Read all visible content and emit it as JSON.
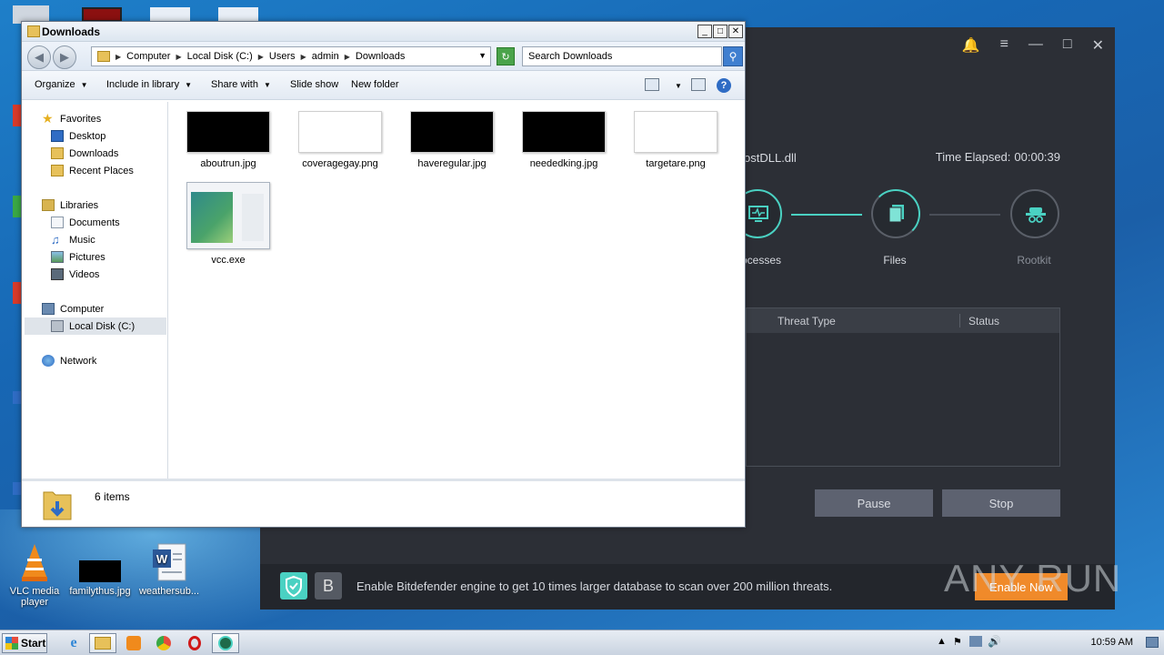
{
  "desktop": {
    "icons": [
      {
        "label": "VLC media player"
      },
      {
        "label": "familythus.jpg"
      },
      {
        "label": "weathersub..."
      }
    ]
  },
  "av_app": {
    "current_file": "ostDLL.dll",
    "elapsed_label": "Time Elapsed:",
    "elapsed_value": "00:00:39",
    "steps": [
      {
        "label": "ocesses",
        "icon": "monitor-icon"
      },
      {
        "label": "Files",
        "icon": "files-icon"
      },
      {
        "label": "Rootkit",
        "icon": "spy-icon"
      }
    ],
    "table_headers": [
      "Threat Type",
      "Status"
    ],
    "pause_label": "Pause",
    "stop_label": "Stop",
    "banner_letter": "B",
    "banner_message": "Enable Bitdefender engine to get 10 times larger database to scan over 200 million threats.",
    "enable_label": "Enable Now",
    "accent": "#4ad1c2"
  },
  "watermark": "ANY RUN",
  "explorer": {
    "title": "Downloads",
    "breadcrumb": [
      "Computer",
      "Local Disk (C:)",
      "Users",
      "admin",
      "Downloads"
    ],
    "search_placeholder": "Search Downloads",
    "toolbar": {
      "organize": "Organize",
      "include_in_library": "Include in library",
      "share_with": "Share with",
      "slide_show": "Slide show",
      "new_folder": "New folder"
    },
    "nav": {
      "favorites": "Favorites",
      "desktop": "Desktop",
      "downloads": "Downloads",
      "recent_places": "Recent Places",
      "libraries": "Libraries",
      "documents": "Documents",
      "music": "Music",
      "pictures": "Pictures",
      "videos": "Videos",
      "computer": "Computer",
      "local_disk": "Local Disk (C:)",
      "network": "Network"
    },
    "files": [
      {
        "name": "aboutrun.jpg"
      },
      {
        "name": "coveragegay.png"
      },
      {
        "name": "haveregular.jpg"
      },
      {
        "name": "neededking.jpg"
      },
      {
        "name": "targetare.png"
      },
      {
        "name": "vcc.exe"
      }
    ],
    "status_count": "6 items"
  },
  "taskbar": {
    "start_label": "Start",
    "clock": "10:59 AM"
  }
}
